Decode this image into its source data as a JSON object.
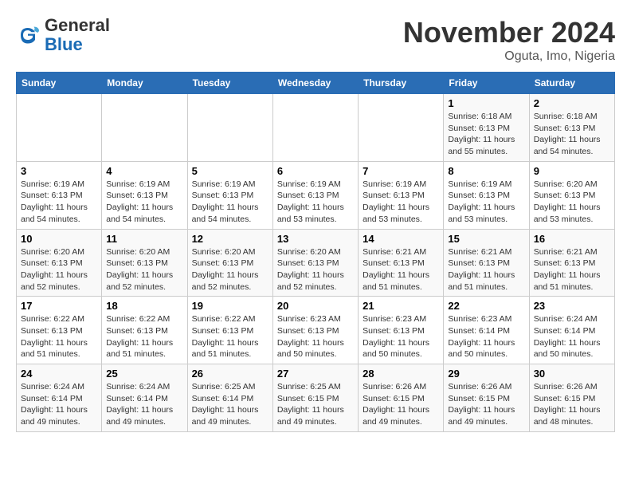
{
  "logo": {
    "line1": "General",
    "line2": "Blue"
  },
  "title": "November 2024",
  "subtitle": "Oguta, Imo, Nigeria",
  "days_of_week": [
    "Sunday",
    "Monday",
    "Tuesday",
    "Wednesday",
    "Thursday",
    "Friday",
    "Saturday"
  ],
  "weeks": [
    [
      {
        "day": "",
        "detail": ""
      },
      {
        "day": "",
        "detail": ""
      },
      {
        "day": "",
        "detail": ""
      },
      {
        "day": "",
        "detail": ""
      },
      {
        "day": "",
        "detail": ""
      },
      {
        "day": "1",
        "detail": "Sunrise: 6:18 AM\nSunset: 6:13 PM\nDaylight: 11 hours\nand 55 minutes."
      },
      {
        "day": "2",
        "detail": "Sunrise: 6:18 AM\nSunset: 6:13 PM\nDaylight: 11 hours\nand 54 minutes."
      }
    ],
    [
      {
        "day": "3",
        "detail": "Sunrise: 6:19 AM\nSunset: 6:13 PM\nDaylight: 11 hours\nand 54 minutes."
      },
      {
        "day": "4",
        "detail": "Sunrise: 6:19 AM\nSunset: 6:13 PM\nDaylight: 11 hours\nand 54 minutes."
      },
      {
        "day": "5",
        "detail": "Sunrise: 6:19 AM\nSunset: 6:13 PM\nDaylight: 11 hours\nand 54 minutes."
      },
      {
        "day": "6",
        "detail": "Sunrise: 6:19 AM\nSunset: 6:13 PM\nDaylight: 11 hours\nand 53 minutes."
      },
      {
        "day": "7",
        "detail": "Sunrise: 6:19 AM\nSunset: 6:13 PM\nDaylight: 11 hours\nand 53 minutes."
      },
      {
        "day": "8",
        "detail": "Sunrise: 6:19 AM\nSunset: 6:13 PM\nDaylight: 11 hours\nand 53 minutes."
      },
      {
        "day": "9",
        "detail": "Sunrise: 6:20 AM\nSunset: 6:13 PM\nDaylight: 11 hours\nand 53 minutes."
      }
    ],
    [
      {
        "day": "10",
        "detail": "Sunrise: 6:20 AM\nSunset: 6:13 PM\nDaylight: 11 hours\nand 52 minutes."
      },
      {
        "day": "11",
        "detail": "Sunrise: 6:20 AM\nSunset: 6:13 PM\nDaylight: 11 hours\nand 52 minutes."
      },
      {
        "day": "12",
        "detail": "Sunrise: 6:20 AM\nSunset: 6:13 PM\nDaylight: 11 hours\nand 52 minutes."
      },
      {
        "day": "13",
        "detail": "Sunrise: 6:20 AM\nSunset: 6:13 PM\nDaylight: 11 hours\nand 52 minutes."
      },
      {
        "day": "14",
        "detail": "Sunrise: 6:21 AM\nSunset: 6:13 PM\nDaylight: 11 hours\nand 51 minutes."
      },
      {
        "day": "15",
        "detail": "Sunrise: 6:21 AM\nSunset: 6:13 PM\nDaylight: 11 hours\nand 51 minutes."
      },
      {
        "day": "16",
        "detail": "Sunrise: 6:21 AM\nSunset: 6:13 PM\nDaylight: 11 hours\nand 51 minutes."
      }
    ],
    [
      {
        "day": "17",
        "detail": "Sunrise: 6:22 AM\nSunset: 6:13 PM\nDaylight: 11 hours\nand 51 minutes."
      },
      {
        "day": "18",
        "detail": "Sunrise: 6:22 AM\nSunset: 6:13 PM\nDaylight: 11 hours\nand 51 minutes."
      },
      {
        "day": "19",
        "detail": "Sunrise: 6:22 AM\nSunset: 6:13 PM\nDaylight: 11 hours\nand 51 minutes."
      },
      {
        "day": "20",
        "detail": "Sunrise: 6:23 AM\nSunset: 6:13 PM\nDaylight: 11 hours\nand 50 minutes."
      },
      {
        "day": "21",
        "detail": "Sunrise: 6:23 AM\nSunset: 6:13 PM\nDaylight: 11 hours\nand 50 minutes."
      },
      {
        "day": "22",
        "detail": "Sunrise: 6:23 AM\nSunset: 6:14 PM\nDaylight: 11 hours\nand 50 minutes."
      },
      {
        "day": "23",
        "detail": "Sunrise: 6:24 AM\nSunset: 6:14 PM\nDaylight: 11 hours\nand 50 minutes."
      }
    ],
    [
      {
        "day": "24",
        "detail": "Sunrise: 6:24 AM\nSunset: 6:14 PM\nDaylight: 11 hours\nand 49 minutes."
      },
      {
        "day": "25",
        "detail": "Sunrise: 6:24 AM\nSunset: 6:14 PM\nDaylight: 11 hours\nand 49 minutes."
      },
      {
        "day": "26",
        "detail": "Sunrise: 6:25 AM\nSunset: 6:14 PM\nDaylight: 11 hours\nand 49 minutes."
      },
      {
        "day": "27",
        "detail": "Sunrise: 6:25 AM\nSunset: 6:15 PM\nDaylight: 11 hours\nand 49 minutes."
      },
      {
        "day": "28",
        "detail": "Sunrise: 6:26 AM\nSunset: 6:15 PM\nDaylight: 11 hours\nand 49 minutes."
      },
      {
        "day": "29",
        "detail": "Sunrise: 6:26 AM\nSunset: 6:15 PM\nDaylight: 11 hours\nand 49 minutes."
      },
      {
        "day": "30",
        "detail": "Sunrise: 6:26 AM\nSunset: 6:15 PM\nDaylight: 11 hours\nand 48 minutes."
      }
    ]
  ]
}
